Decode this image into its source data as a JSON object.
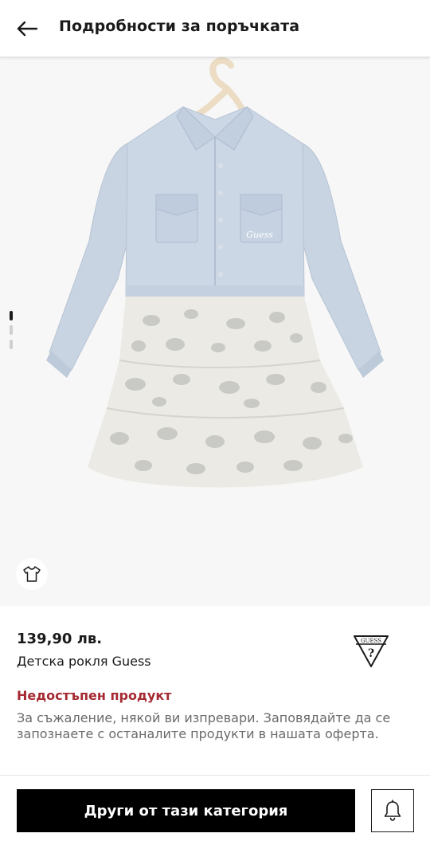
{
  "header": {
    "title": "Подробности за поръчката",
    "back_icon": "arrow-left-icon"
  },
  "gallery": {
    "image_count": 3,
    "active_index": 0,
    "size_icon": "tshirt-icon",
    "image_logo_text": "Guess"
  },
  "product": {
    "price": "139,90 лв.",
    "name": "Детска рокля Guess",
    "brand_logo_text": "GUESS",
    "status": "Недостъпен продукт",
    "status_color": "#a52a32",
    "status_message": "За съжаление, някой ви изпревари. Заповядайте да се запознаете с останалите продукти в нашата оферта."
  },
  "actions": {
    "category_button": "Други от тази категория",
    "notify_icon": "bell-icon"
  }
}
